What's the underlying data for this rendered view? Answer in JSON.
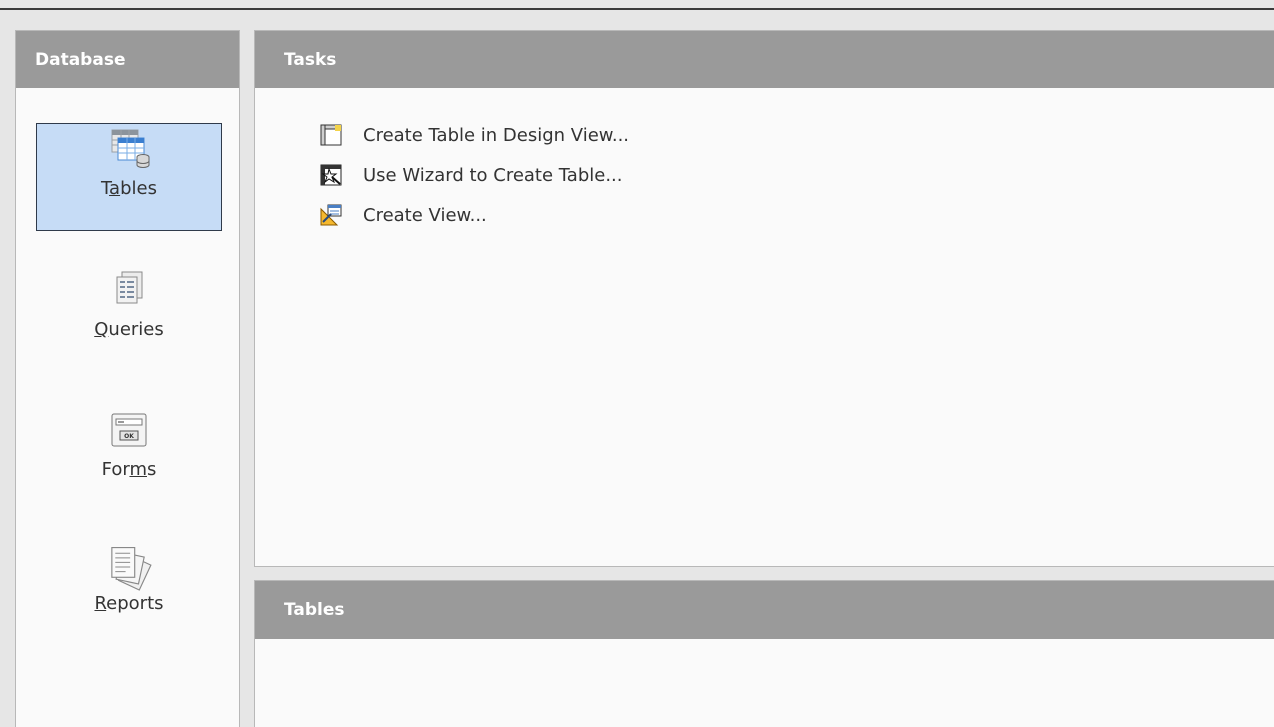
{
  "database_pane": {
    "title": "Database",
    "items": [
      {
        "label_pre": "T",
        "label_u": "a",
        "label_post": "bles",
        "icon": "tables-icon",
        "selected": true
      },
      {
        "label_pre": "",
        "label_u": "Q",
        "label_post": "ueries",
        "icon": "queries-icon",
        "selected": false
      },
      {
        "label_pre": "For",
        "label_u": "m",
        "label_post": "s",
        "icon": "forms-icon",
        "selected": false
      },
      {
        "label_pre": "",
        "label_u": "R",
        "label_post": "eports",
        "icon": "reports-icon",
        "selected": false
      }
    ]
  },
  "tasks_pane": {
    "title": "Tasks",
    "tasks": [
      {
        "label": "Create Table in Design View...",
        "icon": "design-view-icon"
      },
      {
        "label": "Use Wizard to Create Table...",
        "icon": "wizard-icon"
      },
      {
        "label": "Create View...",
        "icon": "create-view-icon"
      }
    ]
  },
  "tables_pane": {
    "title": "Tables"
  },
  "colors": {
    "header_bg": "#9a9a9a",
    "selected_bg": "#c6dcf6",
    "pane_bg": "#fafafa"
  }
}
